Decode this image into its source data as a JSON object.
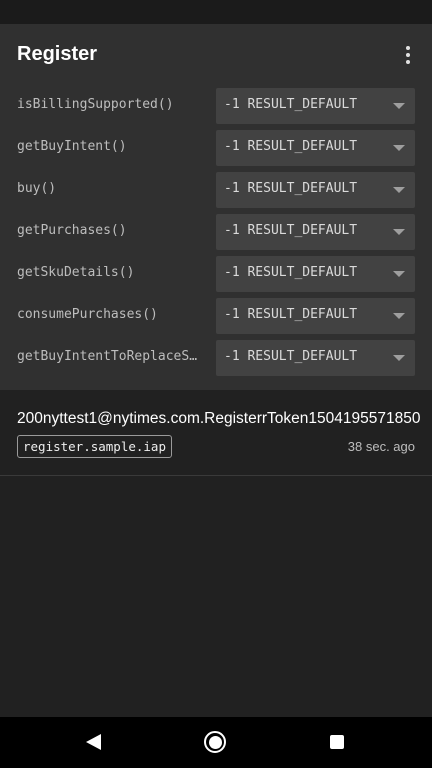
{
  "app_bar": {
    "title": "Register",
    "overflow_icon": "more-vert-icon"
  },
  "config": {
    "rows": [
      {
        "method": "isBillingSupported()",
        "result": "-1 RESULT_DEFAULT"
      },
      {
        "method": "getBuyIntent()",
        "result": "-1 RESULT_DEFAULT"
      },
      {
        "method": "buy()",
        "result": "-1 RESULT_DEFAULT"
      },
      {
        "method": "getPurchases()",
        "result": "-1 RESULT_DEFAULT"
      },
      {
        "method": "getSkuDetails()",
        "result": "-1 RESULT_DEFAULT"
      },
      {
        "method": "consumePurchases()",
        "result": "-1 RESULT_DEFAULT"
      },
      {
        "method": "getBuyIntentToReplaceSkus()",
        "result": "-1 RESULT_DEFAULT"
      }
    ]
  },
  "purchase": {
    "token": "200nyttest1@nytimes.com.RegisterrToken1504195571850",
    "sku": "register.sample.iap",
    "time": "38 sec. ago"
  },
  "nav_bar": {
    "back_icon": "back-triangle-icon",
    "home_icon": "home-circle-icon",
    "recents_icon": "recents-square-icon"
  },
  "colors": {
    "background": "#212121",
    "panel": "#303030",
    "select": "#424242"
  }
}
